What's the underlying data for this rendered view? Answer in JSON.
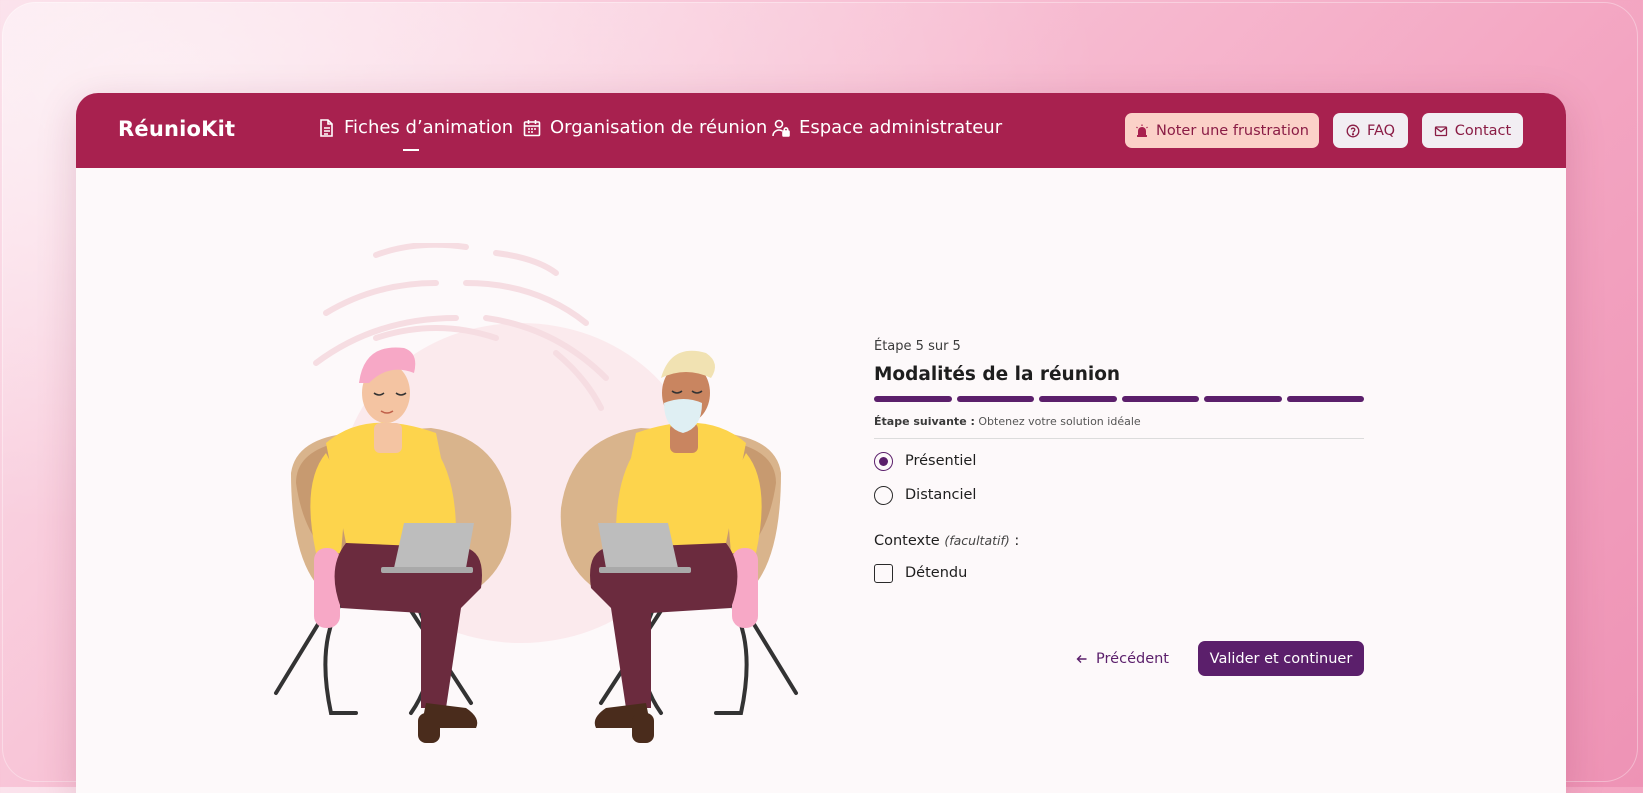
{
  "app": {
    "name": "RéunioKit"
  },
  "nav": {
    "links": [
      {
        "label": "Fiches d’animation",
        "icon": "document-icon",
        "active": true
      },
      {
        "label": "Organisation de réunion",
        "icon": "calendar-icon",
        "active": false
      },
      {
        "label": "Espace administrateur",
        "icon": "user-lock-icon",
        "active": false
      }
    ],
    "buttons": {
      "frustration": {
        "label": "Noter une frustration",
        "icon": "alarm-icon"
      },
      "faq": {
        "label": "FAQ",
        "icon": "question-circle-icon"
      },
      "contact": {
        "label": "Contact",
        "icon": "mail-icon"
      }
    }
  },
  "form": {
    "step_label": "Étape 5 sur 5",
    "title": "Modalités de la réunion",
    "progress": {
      "total_steps": 6,
      "completed_steps": 6
    },
    "next_step_prefix": "Étape suivante :",
    "next_step_text": "Obtenez votre solution idéale",
    "options": [
      {
        "label": "Présentiel",
        "selected": true
      },
      {
        "label": "Distanciel",
        "selected": false
      }
    ],
    "context_label": "Contexte",
    "context_optional": "(facultatif)",
    "context_suffix": " :",
    "context_options": [
      {
        "label": "Détendu",
        "checked": false
      }
    ],
    "prev_label": "Précédent",
    "next_label": "Valider et continuer"
  },
  "colors": {
    "brand": "#a8214f",
    "accent": "#5b1f6b",
    "frustration_bg": "#fbd1c8",
    "shirt": "#fdd44c",
    "pants": "#6b2b3e"
  },
  "illustration": {
    "icon": "two-people-with-laptops-illustration"
  }
}
